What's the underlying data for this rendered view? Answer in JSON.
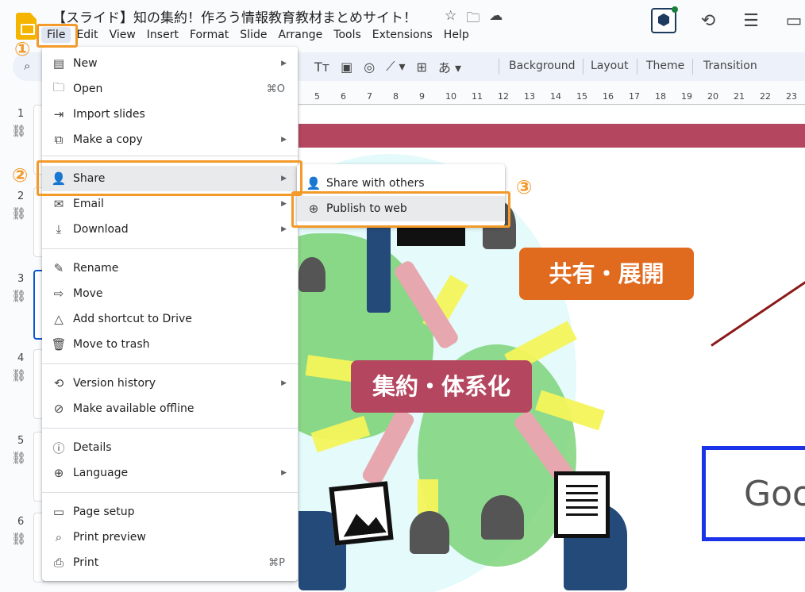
{
  "app": {
    "doc_title": "【スライド】知の集約！作ろう情報教育教材まとめサイト！",
    "title_icons": [
      "star-icon",
      "move-to-folder-icon",
      "cloud-saved-icon"
    ]
  },
  "menubar": [
    "File",
    "Edit",
    "View",
    "Insert",
    "Format",
    "Slide",
    "Arrange",
    "Tools",
    "Extensions",
    "Help"
  ],
  "toolbar": {
    "buttons": [
      "Background",
      "Layout",
      "Theme",
      "Transition"
    ],
    "input_tools_label": "あ"
  },
  "ruler_ticks": [
    "5",
    "6",
    "7",
    "8",
    "9",
    "10",
    "11",
    "12",
    "13",
    "14",
    "15",
    "16",
    "17",
    "18",
    "19",
    "20",
    "21",
    "22",
    "23"
  ],
  "filmstrip": {
    "slides": [
      "1",
      "2",
      "3",
      "4",
      "5",
      "6"
    ],
    "selected": "3"
  },
  "file_menu": {
    "items": [
      {
        "label": "New",
        "icon": "slides-icon",
        "has_submenu": true,
        "shortcut": ""
      },
      {
        "label": "Open",
        "icon": "folder-icon",
        "has_submenu": false,
        "shortcut": "⌘O"
      },
      {
        "label": "Import slides",
        "icon": "import-icon",
        "has_submenu": false,
        "shortcut": ""
      },
      {
        "label": "Make a copy",
        "icon": "copy-icon",
        "has_submenu": true,
        "shortcut": ""
      },
      {
        "label": "Share",
        "icon": "person-add-icon",
        "has_submenu": true,
        "shortcut": ""
      },
      {
        "label": "Email",
        "icon": "mail-icon",
        "has_submenu": true,
        "shortcut": ""
      },
      {
        "label": "Download",
        "icon": "download-icon",
        "has_submenu": true,
        "shortcut": ""
      },
      {
        "label": "Rename",
        "icon": "rename-icon",
        "has_submenu": false,
        "shortcut": ""
      },
      {
        "label": "Move",
        "icon": "move-icon",
        "has_submenu": false,
        "shortcut": ""
      },
      {
        "label": "Add shortcut to Drive",
        "icon": "drive-shortcut-icon",
        "has_submenu": false,
        "shortcut": ""
      },
      {
        "label": "Move to trash",
        "icon": "trash-icon",
        "has_submenu": false,
        "shortcut": ""
      },
      {
        "label": "Version history",
        "icon": "history-icon",
        "has_submenu": true,
        "shortcut": ""
      },
      {
        "label": "Make available offline",
        "icon": "offline-icon",
        "has_submenu": false,
        "shortcut": ""
      },
      {
        "label": "Details",
        "icon": "info-icon",
        "has_submenu": false,
        "shortcut": ""
      },
      {
        "label": "Language",
        "icon": "globe-icon",
        "has_submenu": true,
        "shortcut": ""
      },
      {
        "label": "Page setup",
        "icon": "page-setup-icon",
        "has_submenu": false,
        "shortcut": ""
      },
      {
        "label": "Print preview",
        "icon": "print-preview-icon",
        "has_submenu": false,
        "shortcut": ""
      },
      {
        "label": "Print",
        "icon": "print-icon",
        "has_submenu": false,
        "shortcut": "⌘P"
      }
    ]
  },
  "share_submenu": {
    "items": [
      {
        "label": "Share with others",
        "icon": "person-add-icon"
      },
      {
        "label": "Publish to web",
        "icon": "globe-icon"
      }
    ]
  },
  "slide_content": {
    "badge_share": "共有・展開",
    "badge_collect": "集約・体系化",
    "partial_text": "Goo"
  },
  "annotations": {
    "step1": "①",
    "step2": "②",
    "step3": "③"
  },
  "colors": {
    "highlight": "#f39a2a",
    "badge_share": "#e06a1e",
    "badge_collect": "#b4465f",
    "selection": "#0b57d0"
  }
}
